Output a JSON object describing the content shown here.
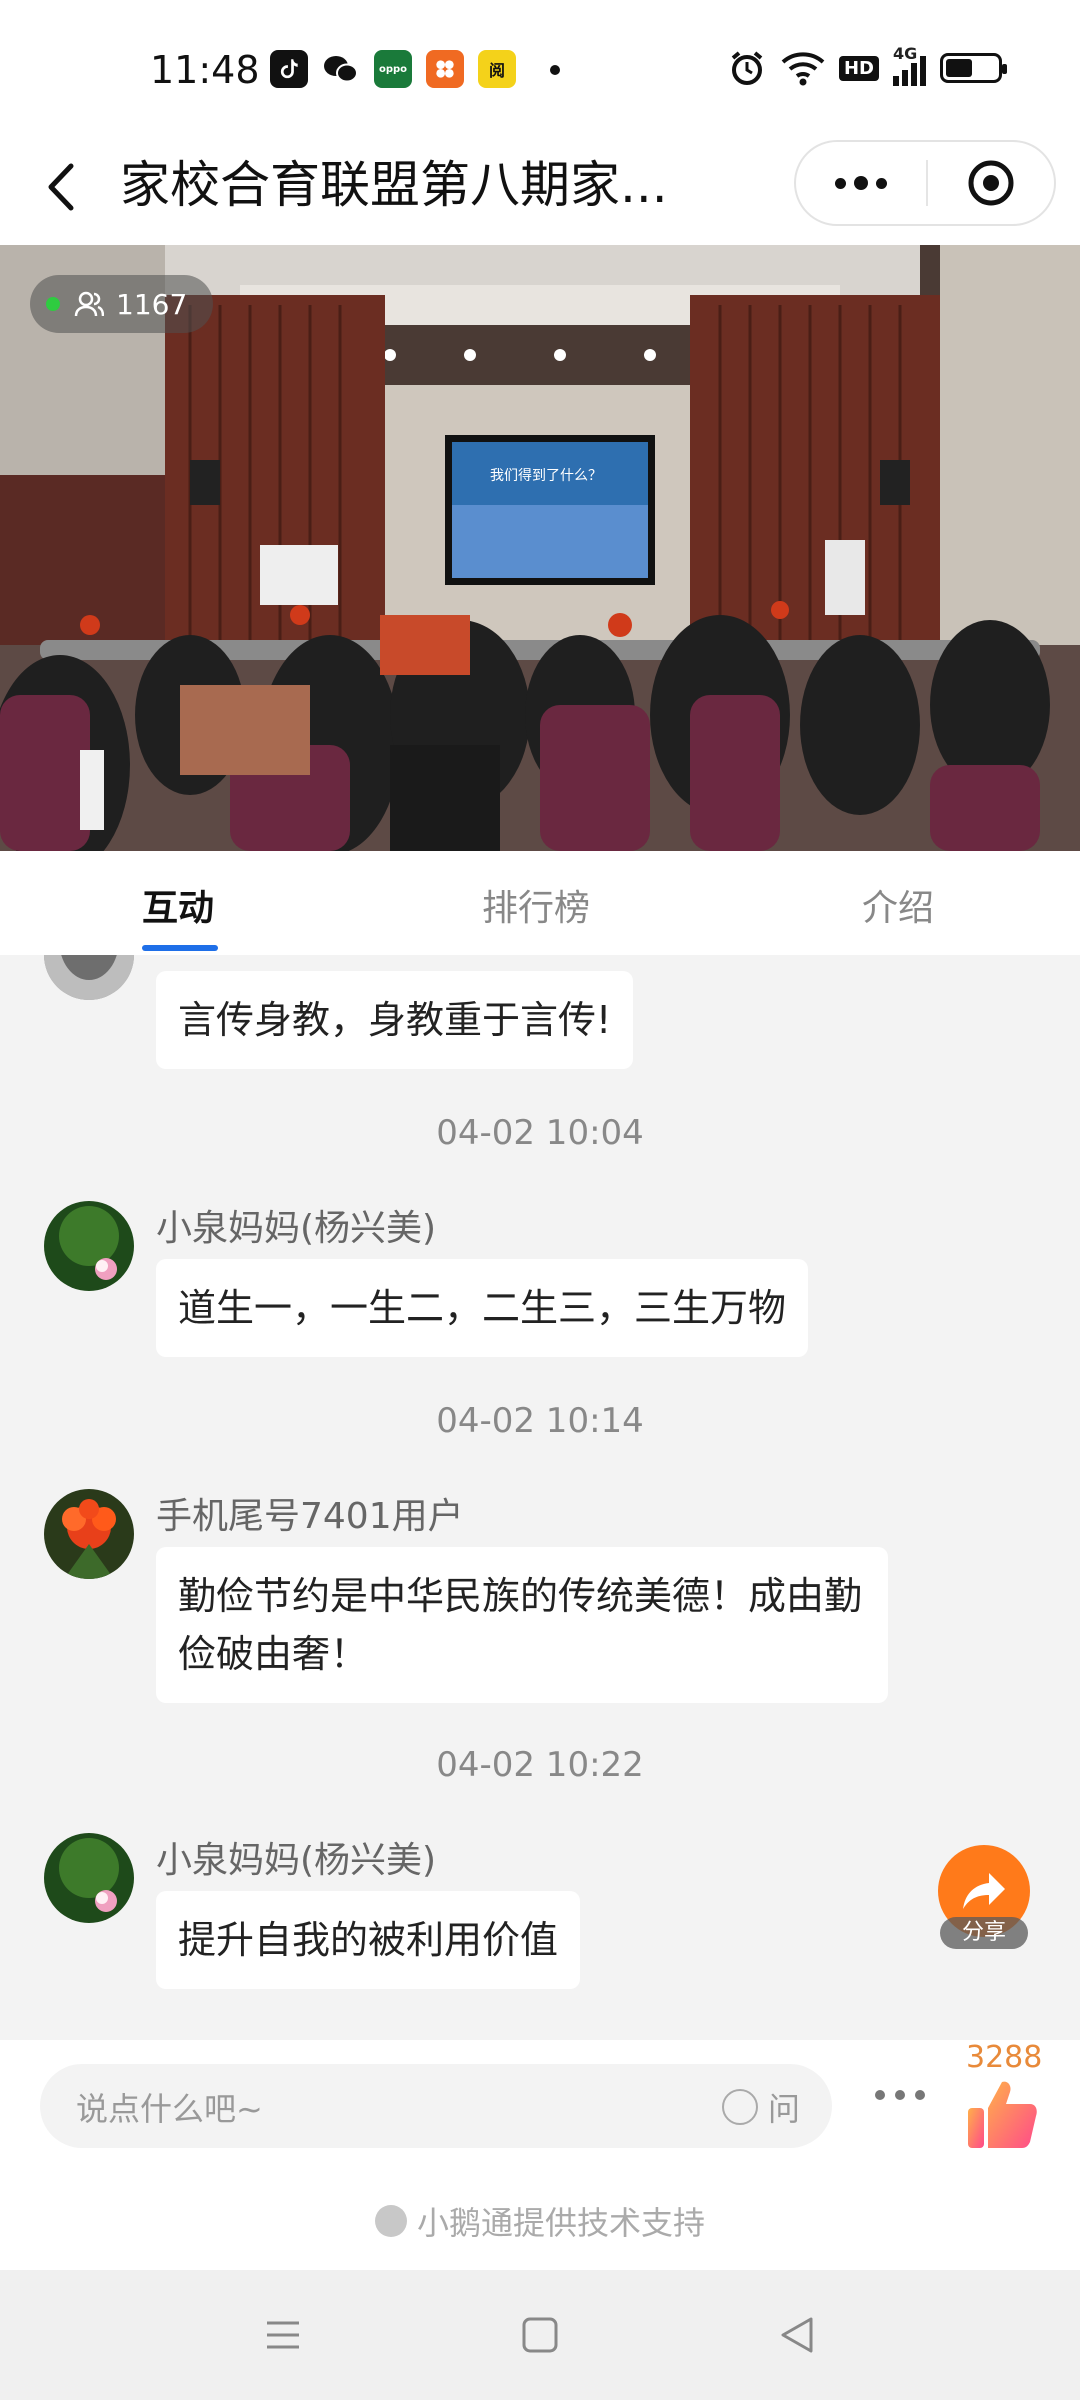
{
  "status_bar": {
    "time": "11:48",
    "apps": [
      {
        "icon": "tiktok-icon",
        "color": "#111111",
        "text": "♪"
      },
      {
        "icon": "wechat-icon",
        "color": "#ffffff",
        "text": ""
      },
      {
        "icon": "oppo-icon",
        "color": "#1a7a3a",
        "text": "oppo"
      },
      {
        "icon": "app-orange-icon",
        "color": "#f06a22",
        "text": "✿"
      },
      {
        "icon": "reader-icon",
        "color": "#f4d21a",
        "text": "阅"
      }
    ],
    "network": "4G",
    "hd": "HD"
  },
  "nav": {
    "title": "家校合育联盟第八期家...",
    "back_icon": "chevron-left-icon",
    "more_icon": "more-dots-icon",
    "close_icon": "target-close-icon"
  },
  "video": {
    "viewer_count": "1167",
    "slide_text": "我们得到了什么？"
  },
  "tabs": [
    {
      "label": "互动",
      "active": true
    },
    {
      "label": "排行榜",
      "active": false
    },
    {
      "label": "介绍",
      "active": false
    }
  ],
  "chat": {
    "messages": [
      {
        "name": "",
        "text": "言传身教，身教重于言传!",
        "avatar": "gray"
      },
      {
        "timestamp": "04-02 10:04"
      },
      {
        "name": "小泉妈妈(杨兴美)",
        "text": "道生一，一生二，二生三，三生万物",
        "avatar": "lotus"
      },
      {
        "timestamp": "04-02 10:14"
      },
      {
        "name": "手机尾号7401用户",
        "text": "勤俭节约是中华民族的传统美德！成由勤俭破由奢！",
        "avatar": "flower"
      },
      {
        "timestamp": "04-02 10:22"
      },
      {
        "name": "小泉妈妈(杨兴美)",
        "text": "提升自我的被利用价值",
        "avatar": "lotus"
      }
    ],
    "share_label": "分享"
  },
  "input_bar": {
    "placeholder": "说点什么吧~",
    "ask_label": "问",
    "like_count": "3288",
    "powered_by": "小鹅通提供技术支持"
  },
  "colors": {
    "accent": "#1e6fe8",
    "share": "#ff7a1a",
    "like": "#ff6a8a"
  }
}
